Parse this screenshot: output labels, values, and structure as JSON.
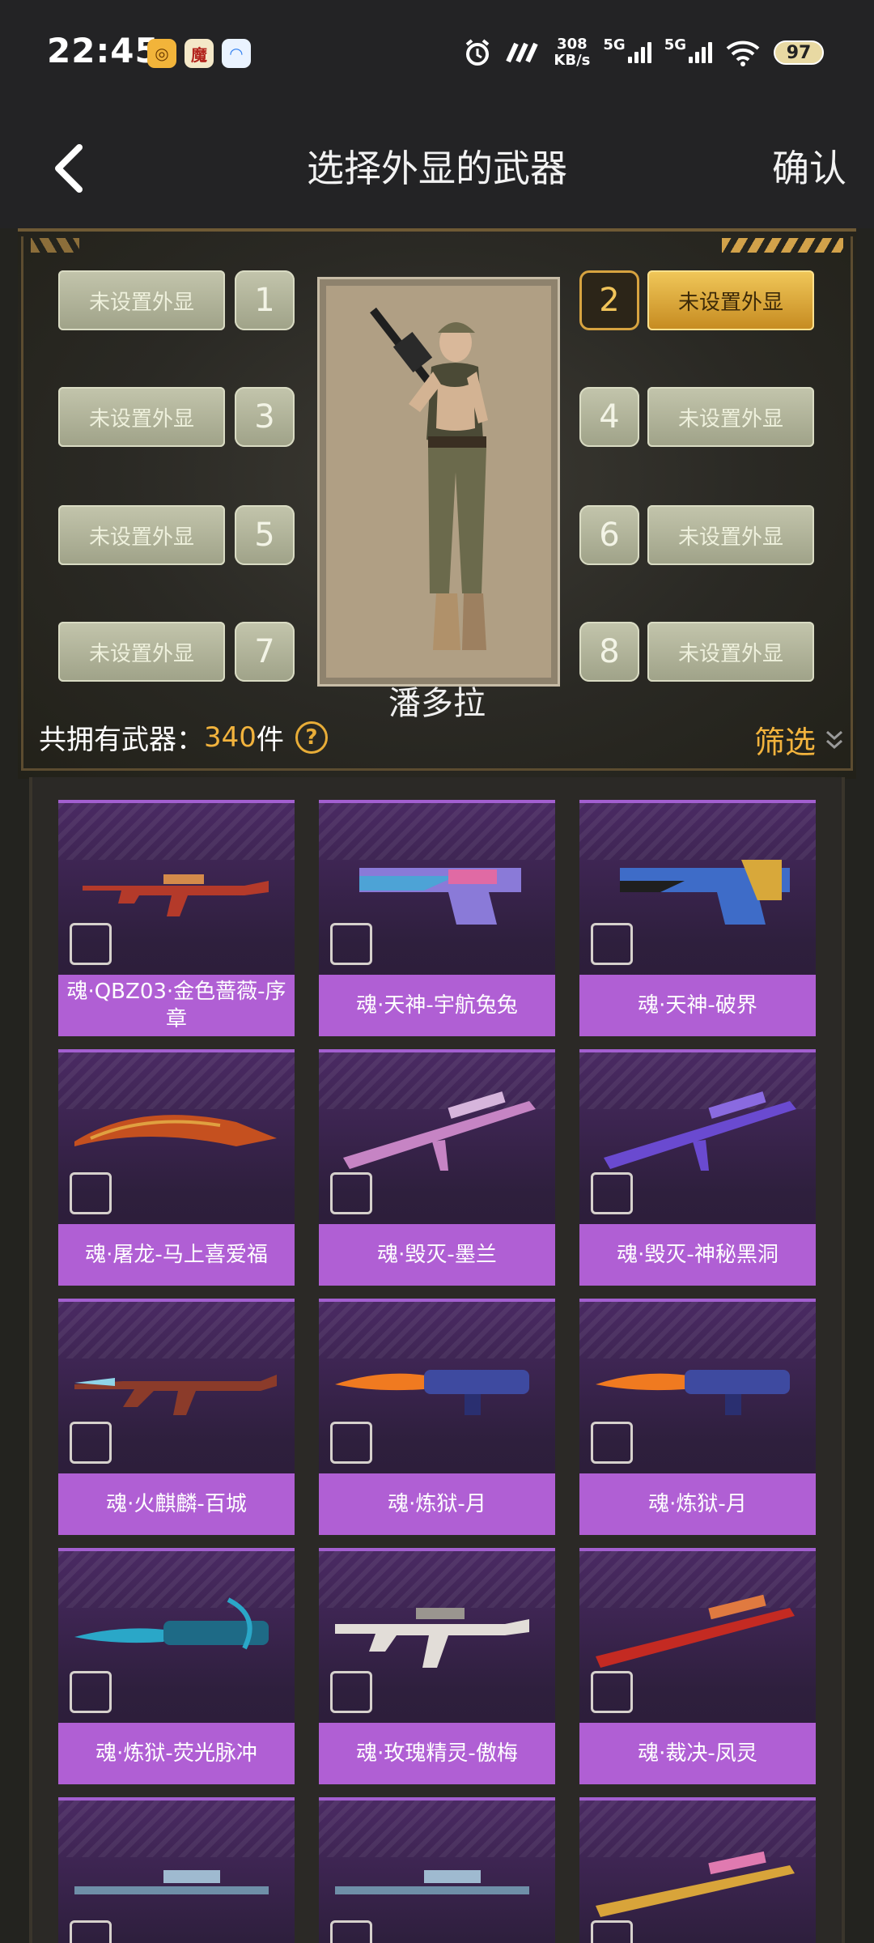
{
  "status_bar": {
    "time": "22:45",
    "net_speed_value": "308",
    "net_speed_unit": "KB/s",
    "signal1": "5G",
    "signal2": "5G",
    "battery": "97"
  },
  "header": {
    "title": "选择外显的武器",
    "confirm_label": "确认"
  },
  "character": {
    "name": "潘多拉"
  },
  "slots": [
    {
      "num": "1",
      "label": "未设置外显"
    },
    {
      "num": "2",
      "label": "未设置外显"
    },
    {
      "num": "3",
      "label": "未设置外显"
    },
    {
      "num": "4",
      "label": "未设置外显"
    },
    {
      "num": "5",
      "label": "未设置外显"
    },
    {
      "num": "6",
      "label": "未设置外显"
    },
    {
      "num": "7",
      "label": "未设置外显"
    },
    {
      "num": "8",
      "label": "未设置外显"
    }
  ],
  "summary": {
    "prefix": "共拥有武器：",
    "count": "340",
    "unit": "件",
    "help": "?",
    "filter_label": "筛选"
  },
  "weapons": [
    {
      "name": "魂·QBZ03·金色蔷薇-序章"
    },
    {
      "name": "魂·天神-宇航兔兔"
    },
    {
      "name": "魂·天神-破界"
    },
    {
      "name": "魂·屠龙-马上喜爱福"
    },
    {
      "name": "魂·毁灭-墨兰"
    },
    {
      "name": "魂·毁灭-神秘黑洞"
    },
    {
      "name": "魂·火麒麟-百城"
    },
    {
      "name": "魂·炼狱-月"
    },
    {
      "name": "魂·炼狱-月"
    },
    {
      "name": "魂·炼狱-荧光脉冲"
    },
    {
      "name": "魂·玫瑰精灵-傲梅"
    },
    {
      "name": "魂·裁决-凤灵"
    }
  ]
}
